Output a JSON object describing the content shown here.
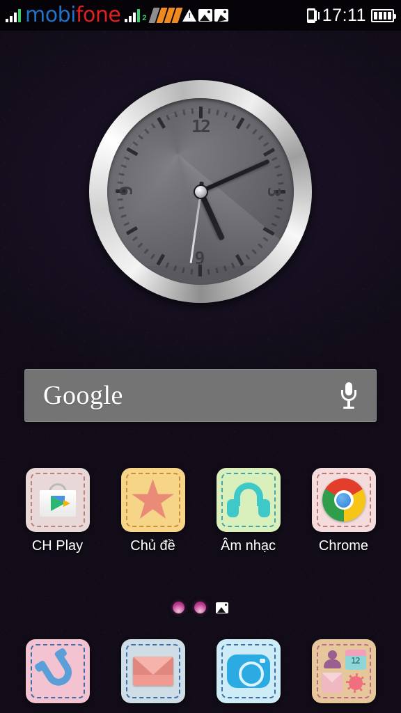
{
  "status_bar": {
    "carrier_prefix": "mobi",
    "carrier_suffix": "fone",
    "sim2_label": "2",
    "time": "17:11",
    "icons": {
      "signal1": "signal-bars-icon",
      "signal2": "signal-bars-sim2-icon",
      "data": "data-network-icon",
      "warning": "warning-triangle-icon",
      "screenshot1": "screenshot-icon",
      "screenshot2": "screenshot-edit-icon",
      "vibrate": "vibrate-mode-icon",
      "battery": "battery-icon"
    },
    "battery_segments": 4
  },
  "clock_widget": {
    "name": "analog-clock-widget",
    "numerals": {
      "n12": "12",
      "n3": "3",
      "n6": "6",
      "n9": "9"
    },
    "time": "17:11",
    "hour_angle": 155.5,
    "minute_angle": 66,
    "second_angle": 188,
    "bezel_color": "#e8e8e8",
    "face_color": "#63636a"
  },
  "search": {
    "label": "Google",
    "placeholder": "Google",
    "mic_icon": "microphone-icon",
    "bg_color": "#747474"
  },
  "apps": [
    {
      "label": "CH Play",
      "icon": "play-store-icon",
      "tile_color": "#e8d8d8",
      "dash_color": "#c0807c"
    },
    {
      "label": "Chủ đề",
      "icon": "theme-star-icon",
      "tile_color": "#f6d488",
      "dash_color": "#c98f3e"
    },
    {
      "label": "Âm nhạc",
      "icon": "headphones-icon",
      "tile_color": "#d9f0bd",
      "dash_color": "#49a3a3"
    },
    {
      "label": "Chrome",
      "icon": "chrome-icon",
      "tile_color": "#f4dcdc",
      "dash_color": "#c07878"
    }
  ],
  "page_indicator": {
    "total": 2,
    "current": 1
  },
  "dock": [
    {
      "label": "Phone",
      "icon": "phone-handset-icon",
      "tile_color": "#f3c3d2",
      "dash_color": "#3f6fa8"
    },
    {
      "label": "Messaging",
      "icon": "envelope-icon",
      "tile_color": "#cfdde6",
      "dash_color": "#3f6fa8"
    },
    {
      "label": "Camera",
      "icon": "camera-icon",
      "tile_color": "#cdecf5",
      "dash_color": "#3f6fa8"
    },
    {
      "label": "App Drawer",
      "icon": "app-drawer-icon",
      "tile_color": "#e6c79b",
      "dash_color": "#c06a8a",
      "mini": {
        "calendar_day": "12"
      }
    }
  ],
  "wallpaper": {
    "color": "#15101f"
  }
}
